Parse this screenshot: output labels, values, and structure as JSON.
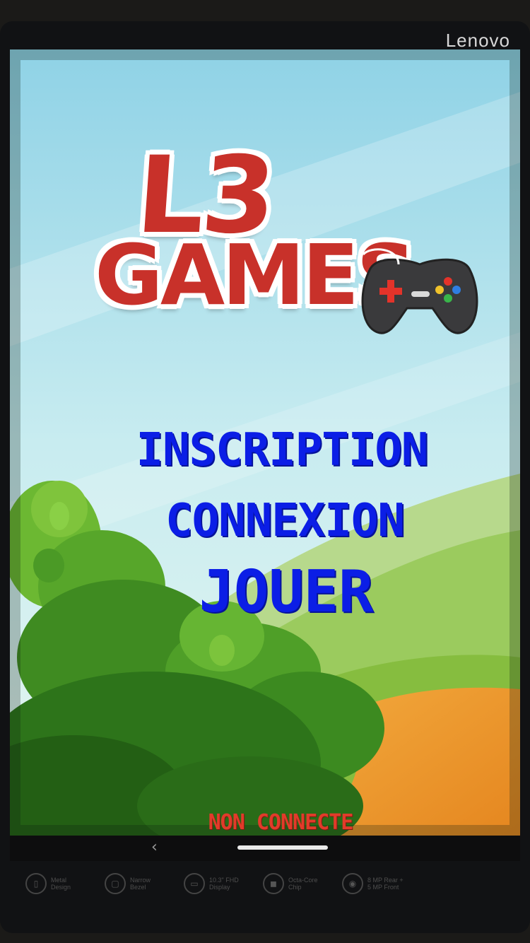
{
  "device": {
    "brand": "Lenovo"
  },
  "logo": {
    "line1": "L3",
    "line2": "GAMES",
    "icon": "gamepad-icon"
  },
  "menu": {
    "inscription": "INSCRIPTION",
    "connexion": "CONNEXION",
    "jouer": "JOUER"
  },
  "status": {
    "text": "NON CONNECTE"
  },
  "navbar": {
    "back_icon": "back-chevron-icon",
    "back_glyph": "‹"
  },
  "features": [
    {
      "icon": "metal-design-icon",
      "glyph": "▯",
      "label": "Metal\nDesign"
    },
    {
      "icon": "narrow-bezel-icon",
      "glyph": "▢",
      "label": "Narrow\nBezel"
    },
    {
      "icon": "display-icon",
      "glyph": "▭",
      "label": "10.3\" FHD\nDisplay"
    },
    {
      "icon": "chip-icon",
      "glyph": "◼",
      "label": "Octa-Core\nChip"
    },
    {
      "icon": "camera-icon",
      "glyph": "◉",
      "label": "8 MP Rear +\n5 MP Front"
    }
  ],
  "colors": {
    "menu_text": "#0b1ee6",
    "status_text": "#e23b2a",
    "logo_red": "#c8312a"
  }
}
